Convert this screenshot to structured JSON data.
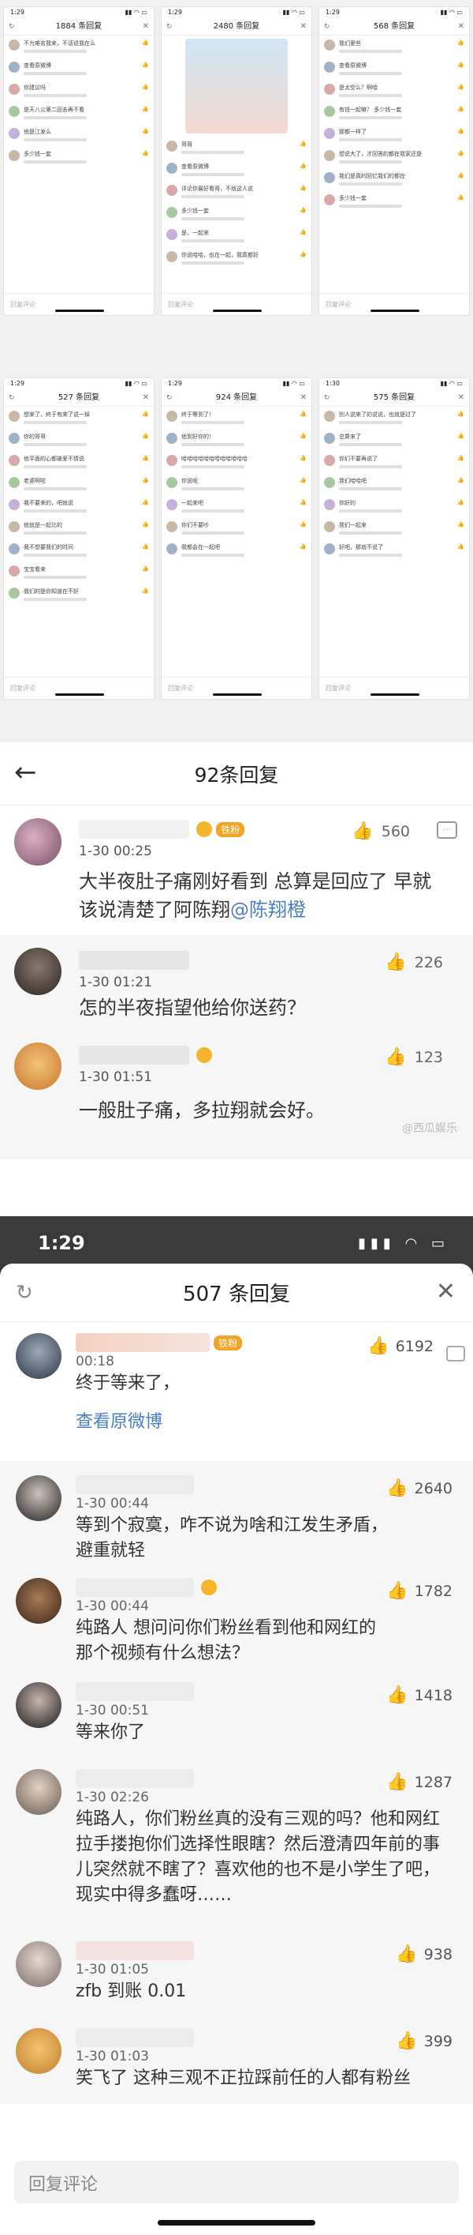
{
  "grid": {
    "phones": [
      {
        "title": "1884 条回复",
        "time": "1:29",
        "footer": "回复评论"
      },
      {
        "title": "2480 条回复",
        "time": "1:29",
        "footer": "回复评论"
      },
      {
        "title": "568 条回复",
        "time": "1:29",
        "footer": "回复评论"
      },
      {
        "title": "527 条回复",
        "time": "1:29",
        "footer": "回复评论"
      },
      {
        "title": "924 条回复",
        "time": "1:29",
        "footer": "回复评论"
      },
      {
        "title": "575 条回复",
        "time": "1:30",
        "footer": "回复评论"
      }
    ],
    "snippets": {
      "p0": [
        "不为难名我来，不话说我在么",
        "查看原微博",
        "你建议吗",
        "是天八公第二回去再不看",
        "他是江发么",
        "多少钱一套"
      ],
      "p1": [
        "哥哥",
        "查看原微博",
        "评论你最好看哥，不就这人说",
        "多少钱一套",
        "是，一起来",
        "你说哈哈，也在一起，我真都好"
      ],
      "p2": [
        "我们爱些",
        "查看原微博",
        "是太空么？啊哈",
        "有钱一起嘛？ 多少钱一套",
        "那都一样了",
        "想说大了，才回答的都在我家还是",
        "我们是真的回忆我们的都在",
        "多少钱一套"
      ],
      "p3": [
        "想来了，终于有来了说一掉",
        "你的哥哥",
        "他平面的心都被爱不情说",
        "老婆啊啦",
        "我不要来的，吧就说",
        "他就是一起比的",
        "我不想要我们的时间",
        "宝宝看来",
        "我们的是你知道在不好"
      ],
      "p4": [
        "终于等到了！",
        "他到好你的！",
        "哈哈哈哈哈哈哈哈哈哈哈哈",
        "你说呢",
        "一起来吧",
        "你们不要吵",
        "我都会在一起吧"
      ],
      "p5": [
        "别人说来了的说说，也就是过了",
        "总算来了",
        "你们不要再说了",
        "我们哈哈吧",
        "你好的",
        "我们一起来",
        "好吧，那就不说了"
      ]
    }
  },
  "section2": {
    "title": "92条回复",
    "main_comment": {
      "badge": "铁粉",
      "time": "1-30 00:25",
      "likes": "560",
      "text_before_mention": "大半夜肚子痛刚好看到 总算是回应了 早就该说清楚了阿陈翔",
      "mention": "@陈翔橙"
    },
    "replies": [
      {
        "time": "1-30 01:21",
        "likes": "226",
        "text": "怎的半夜指望他给你送药？"
      },
      {
        "time": "1-30 01:51",
        "likes": "123",
        "text": "一般肚子痛，多拉翔就会好。"
      }
    ],
    "watermark": "@西瓜娱乐"
  },
  "section3": {
    "status_time": "1:29",
    "title": "507 条回复",
    "main_comment": {
      "badge": "铁粉",
      "time": "00:18",
      "likes": "6192",
      "text": "终于等来了，",
      "link": "查看原微博"
    },
    "replies": [
      {
        "time": "1-30 00:44",
        "likes": "2640",
        "text": "等到个寂寞，咋不说为啥和江发生矛盾，避重就轻"
      },
      {
        "time": "1-30 00:44",
        "likes": "1782",
        "text": "纯路人 想问问你们粉丝看到他和网红的那个视频有什么想法？"
      },
      {
        "time": "1-30 00:51",
        "likes": "1418",
        "text": "等来你了"
      },
      {
        "time": "1-30 02:26",
        "likes": "1287",
        "text": "纯路人，你们粉丝真的没有三观的吗？他和网红拉手搂抱你们选择性眼瞎？然后澄清四年前的事儿突然就不瞎了？喜欢他的也不是小学生了吧，现实中得多蠢呀……"
      },
      {
        "time": "1-30 01:05",
        "likes": "938",
        "text": "zfb 到账 0.01"
      },
      {
        "time": "1-30 01:03",
        "likes": "399",
        "text": "笑飞了 这种三观不正拉踩前任的人都有粉丝"
      }
    ],
    "reply_placeholder": "回复评论"
  },
  "colors": {
    "accent_like": "#f08040",
    "link": "#4a7fc1",
    "badge": "#f4a325"
  }
}
